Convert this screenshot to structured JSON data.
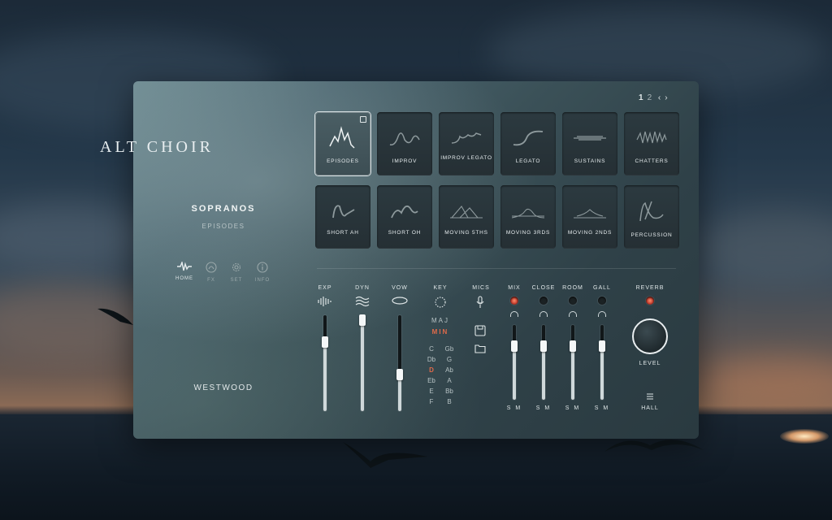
{
  "app": {
    "title": "ALT CHOIR",
    "brand": "WESTWOOD"
  },
  "instrument": {
    "name": "SOPRANOS",
    "articulation": "EPISODES"
  },
  "nav": [
    {
      "label": "HOME",
      "icon": "waveform-icon",
      "active": true
    },
    {
      "label": "FX",
      "icon": "fx-icon",
      "active": false
    },
    {
      "label": "SET",
      "icon": "gear-icon",
      "active": false
    },
    {
      "label": "INFO",
      "icon": "info-icon",
      "active": false
    }
  ],
  "pager": {
    "pages": [
      "1",
      "2"
    ],
    "current": "1"
  },
  "articulations": [
    {
      "label": "EPISODES",
      "selected": true
    },
    {
      "label": "IMPROV",
      "selected": false
    },
    {
      "label": "IMPROV LEGATO",
      "selected": false
    },
    {
      "label": "LEGATO",
      "selected": false
    },
    {
      "label": "SUSTAINS",
      "selected": false
    },
    {
      "label": "CHATTERS",
      "selected": false
    },
    {
      "label": "SHORT AH",
      "selected": false
    },
    {
      "label": "SHORT OH",
      "selected": false
    },
    {
      "label": "MOVING 5THS",
      "selected": false
    },
    {
      "label": "MOVING 3RDS",
      "selected": false
    },
    {
      "label": "MOVING 2NDS",
      "selected": false
    },
    {
      "label": "PERCUSSION",
      "selected": false
    }
  ],
  "controls": {
    "exp": {
      "label": "EXP",
      "value": 0.72
    },
    "dyn": {
      "label": "DYN",
      "value": 0.95
    },
    "vow": {
      "label": "VOW",
      "value": 0.38
    }
  },
  "key": {
    "label": "KEY",
    "modes": [
      "MAJ",
      "MIN"
    ],
    "selected_mode": "MIN",
    "notes_left": [
      "C",
      "Db",
      "D",
      "Eb",
      "E",
      "F"
    ],
    "notes_right": [
      "Gb",
      "G",
      "Ab",
      "A",
      "Bb",
      "B"
    ],
    "selected_note": "D"
  },
  "mics": {
    "label": "MICS",
    "channels": [
      {
        "label": "MIX",
        "enabled": true,
        "value": 0.72,
        "sm": "S M"
      },
      {
        "label": "CLOSE",
        "enabled": false,
        "value": 0.72,
        "sm": "S M"
      },
      {
        "label": "ROOM",
        "enabled": false,
        "value": 0.72,
        "sm": "S M"
      },
      {
        "label": "GALL",
        "enabled": false,
        "value": 0.72,
        "sm": "S M"
      }
    ]
  },
  "reverb": {
    "label": "REVERB",
    "enabled": true,
    "level_label": "LEVEL",
    "preset": "HALL"
  },
  "colors": {
    "accent": "#e06a4a",
    "led_on": "#c0392b"
  }
}
